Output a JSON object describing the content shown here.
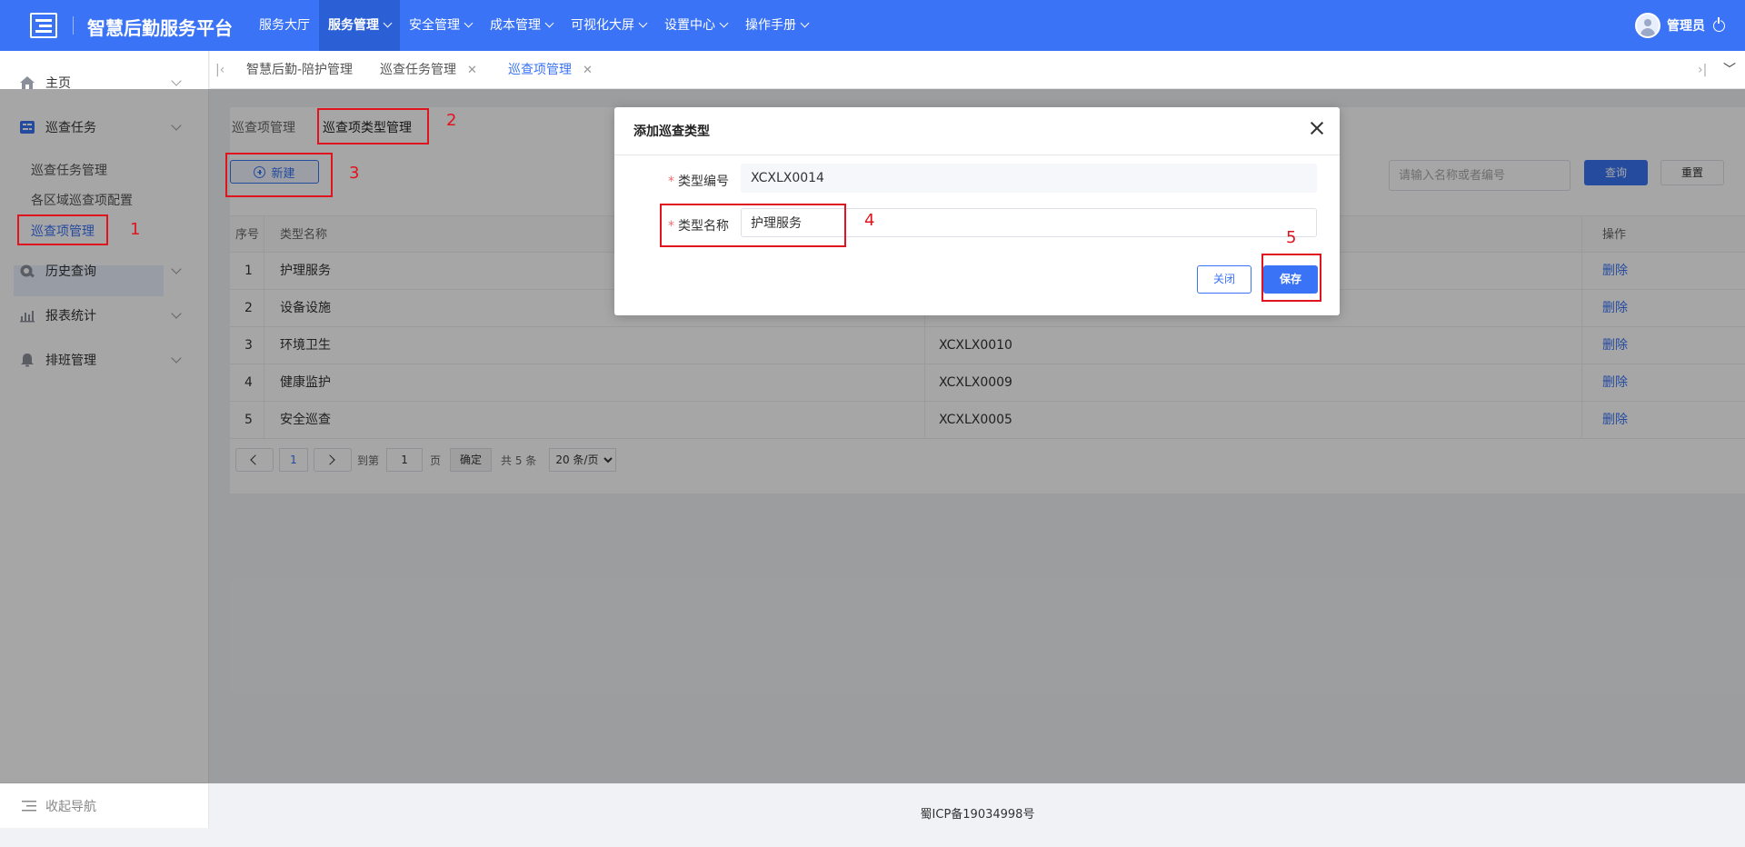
{
  "app": {
    "title": "智慧后勤服务平台"
  },
  "nav": [
    {
      "label": "服务大厅",
      "dropdown": false,
      "active": false
    },
    {
      "label": "服务管理",
      "dropdown": true,
      "active": true
    },
    {
      "label": "安全管理",
      "dropdown": true,
      "active": false
    },
    {
      "label": "成本管理",
      "dropdown": true,
      "active": false
    },
    {
      "label": "可视化大屏",
      "dropdown": true,
      "active": false
    },
    {
      "label": "设置中心",
      "dropdown": true,
      "active": false
    },
    {
      "label": "操作手册",
      "dropdown": true,
      "active": false
    }
  ],
  "user": {
    "name": "管理员"
  },
  "sidebar": {
    "items": [
      {
        "label": "主页",
        "icon": "home-icon"
      },
      {
        "label": "巡查任务",
        "icon": "task-icon",
        "expanded": true
      },
      {
        "label": "历史查询",
        "icon": "history-icon"
      },
      {
        "label": "报表统计",
        "icon": "chart-icon"
      },
      {
        "label": "排班管理",
        "icon": "bell-icon"
      }
    ],
    "subitems": [
      "巡查任务管理",
      "各区域巡查项配置",
      "巡查项管理"
    ],
    "collapse_label": "收起导航"
  },
  "tabs": [
    {
      "label": "智慧后勤-陪护管理",
      "closable": false,
      "active": false
    },
    {
      "label": "巡查任务管理",
      "closable": true,
      "active": false
    },
    {
      "label": "巡查项管理",
      "closable": true,
      "active": true
    }
  ],
  "subtabs": [
    "巡查项管理",
    "巡查项类型管理"
  ],
  "toolbar": {
    "new_label": "新建",
    "search_placeholder": "请输入名称或者编号",
    "query_label": "查询",
    "reset_label": "重置"
  },
  "table": {
    "headers": [
      "序号",
      "类型名称",
      "操作"
    ],
    "rows": [
      {
        "no": "1",
        "name": "护理服务",
        "code": "",
        "action": "删除"
      },
      {
        "no": "2",
        "name": "设备设施",
        "code": "",
        "action": "删除"
      },
      {
        "no": "3",
        "name": "环境卫生",
        "code": "XCXLX0010",
        "action": "删除"
      },
      {
        "no": "4",
        "name": "健康监护",
        "code": "XCXLX0009",
        "action": "删除"
      },
      {
        "no": "5",
        "name": "安全巡查",
        "code": "XCXLX0005",
        "action": "删除"
      }
    ]
  },
  "pager": {
    "current": "1",
    "goto_prefix": "到第",
    "goto_value": "1",
    "goto_suffix": "页",
    "confirm": "确定",
    "total": "共 5 条",
    "page_size": "20 条/页"
  },
  "dialog": {
    "title": "添加巡查类型",
    "code_label": "类型编号",
    "code_value": "XCXLX0014",
    "name_label": "类型名称",
    "name_value": "护理服务",
    "cancel_label": "关闭",
    "save_label": "保存"
  },
  "annotations": [
    "1",
    "2",
    "3",
    "4",
    "5"
  ],
  "footer": {
    "icp": "蜀ICP备19034998号"
  },
  "colors": {
    "primary": "#3a73f5",
    "annotation": "#e0141e",
    "topbar": "#3a73f5"
  }
}
